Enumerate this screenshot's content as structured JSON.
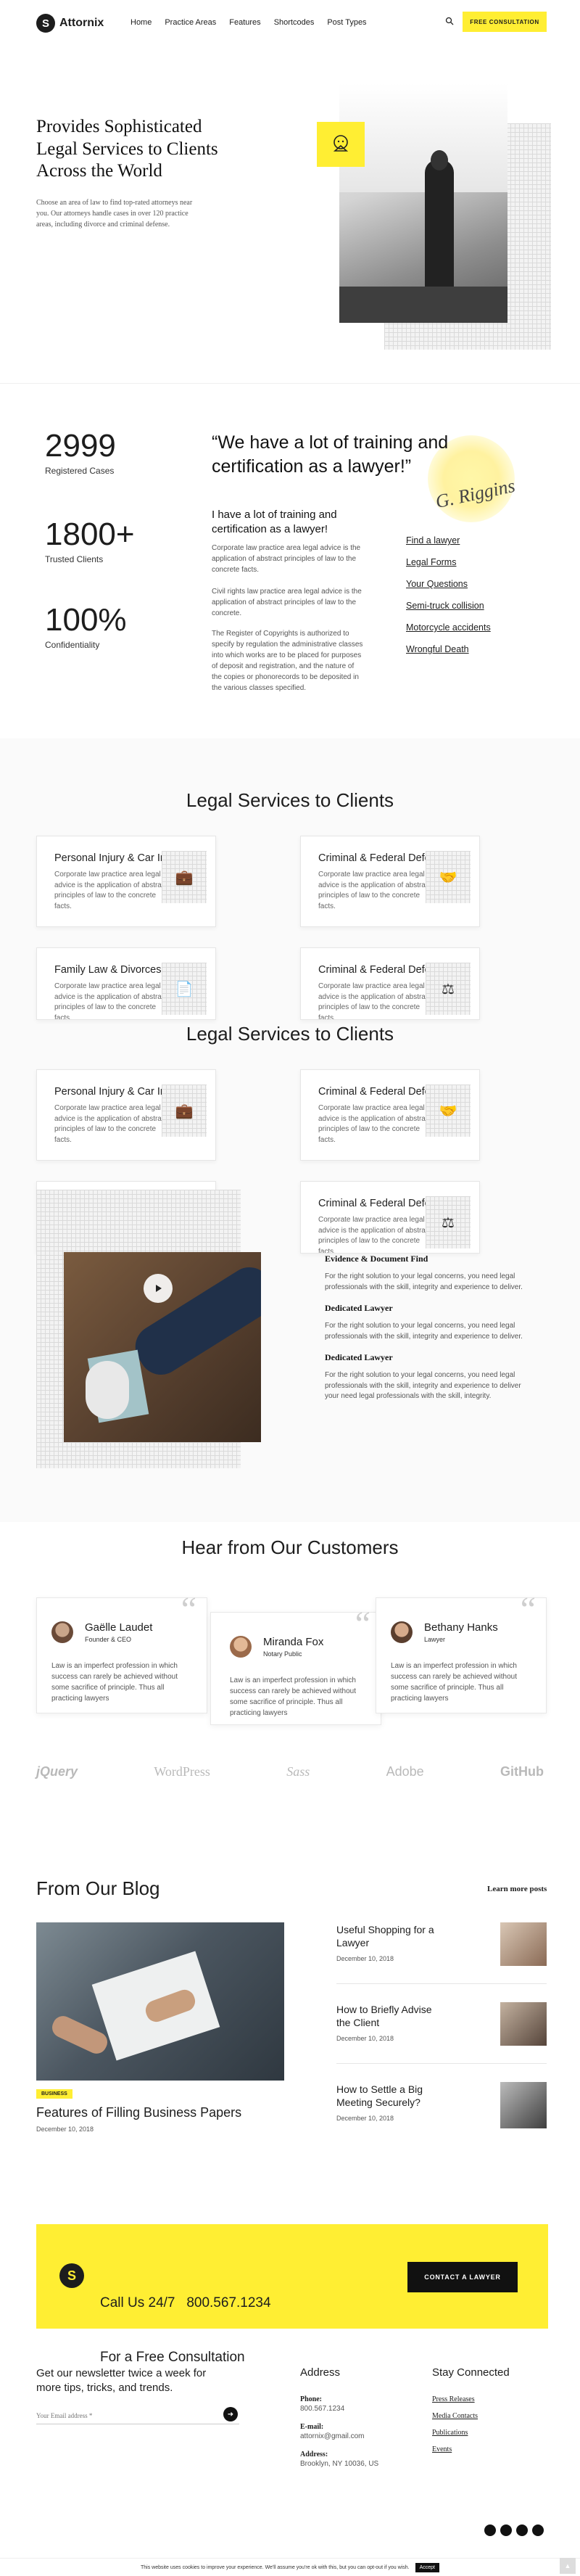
{
  "header": {
    "brand": "Attornix",
    "nav": [
      "Home",
      "Practice Areas",
      "Features",
      "Shortcodes",
      "Post Types"
    ],
    "cta": "FREE CONSULTATION"
  },
  "hero": {
    "title_lines": [
      "Provides Sophisticated",
      "Legal Services to Clients",
      "Across the World"
    ],
    "text": "Choose an area of law to find top-rated attorneys near you. Our attorneys handle cases in over 120 practice areas, including divorce and criminal defense."
  },
  "stats": [
    {
      "value": "2999",
      "label": "Registered Cases"
    },
    {
      "value": "1800+",
      "label": "Trusted Clients"
    },
    {
      "value": "100%",
      "label": "Confidentiality"
    }
  ],
  "quote": {
    "text": "“We have a lot of training and certification as a lawyer!”",
    "signature": "G. Riggins",
    "subtitle": "I have a lot of training and certification as a lawyer!",
    "paragraphs": [
      "Corporate law practice area legal advice is the application of abstract principles of law to the concrete facts.",
      "Civil rights law practice area legal advice is the application of abstract principles of law to the concrete.",
      "The Register of Copyrights is authorized to specify by regulation the administrative classes into which works are to be placed for purposes of deposit and registration, and the nature of the copies or phonorecords to be deposited in the various classes specified."
    ],
    "links": [
      "Find a lawyer",
      "Legal Forms",
      "Your Questions",
      "Semi-truck collision",
      "Motorcycle accidents",
      "Wrongful Death"
    ]
  },
  "services": {
    "title": "Legal Services to Clients",
    "cards": [
      {
        "title": "Personal Injury & Car Incidents",
        "text": "Corporate law practice area legal advice is the application of abstract principles of law to the concrete facts.",
        "icon": "briefcase-icon",
        "glyph": "💼"
      },
      {
        "title": "Criminal & Federal Defences",
        "text": "Corporate law practice area legal advice is the application of abstract principles of law to the concrete facts.",
        "icon": "handshake-icon",
        "glyph": "🤝"
      },
      {
        "title": "Family Law & Divorces",
        "text": "Corporate law practice area legal advice is the application of abstract principles of law to the concrete facts.",
        "icon": "document-icon",
        "glyph": "📄"
      },
      {
        "title": "Criminal & Federal Defences",
        "text": "Corporate law practice area legal advice is the application of abstract principles of law to the concrete facts.",
        "icon": "scales-icon",
        "glyph": "⚖"
      }
    ]
  },
  "features": [
    {
      "title": "Evidence & Document Find",
      "text": "For the right solution to your legal concerns, you need legal professionals with the skill, integrity and experience to deliver."
    },
    {
      "title": "Dedicated Lawyer",
      "text": "For the right solution to your legal concerns, you need legal professionals with the skill, integrity and experience to deliver."
    },
    {
      "title": "Dedicated Lawyer",
      "text": "For the right solution to your legal concerns, you need legal professionals with the skill, integrity and experience to deliver your need legal professionals with the skill, integrity."
    }
  ],
  "testimonials": {
    "title": "Hear from Our Customers",
    "items": [
      {
        "name": "Gaëlle Laudet",
        "role": "Founder & CEO",
        "text": "Law is an imperfect profession in which success can rarely be achieved without some sacrifice of principle. Thus all practicing lawyers"
      },
      {
        "name": "Miranda Fox",
        "role": "Notary Public",
        "text": "Law is an imperfect profession in which success can rarely be achieved without some sacrifice of principle. Thus all practicing lawyers"
      },
      {
        "name": "Bethany Hanks",
        "role": "Lawyer",
        "text": "Law is an imperfect profession in which success can rarely be achieved without some sacrifice of principle. Thus all practicing lawyers"
      }
    ]
  },
  "partners": [
    "jQuery",
    "WordPress",
    "Sass",
    "Adobe",
    "GitHub"
  ],
  "blog": {
    "title": "From Our Blog",
    "more": "Learn more posts",
    "featured": {
      "tag": "BUSINESS",
      "title": "Features of Filling Business Papers",
      "date": "December 10, 2018"
    },
    "posts": [
      {
        "title": "Useful Shopping for a Lawyer",
        "date": "December 10, 2018"
      },
      {
        "title": "How to Briefly Advise the Client",
        "date": "December 10, 2018"
      },
      {
        "title": "How to Settle a Big Meeting Securely?",
        "date": "December 10, 2018"
      }
    ]
  },
  "cta": {
    "line1": "Call Us 24/7   800.567.1234",
    "line2": "For a Free Consultation",
    "button": "CONTACT A LAWYER"
  },
  "footer": {
    "newsletter": "Get our newsletter twice a week for more tips, tricks, and trends.",
    "email_placeholder": "Your Email address *",
    "address_title": "Address",
    "phone_label": "Phone:",
    "phone": "800.567.1234",
    "email_label": "E-mail:",
    "email": "attornix@gmail.com",
    "addr_label": "Address:",
    "addr": "Brooklyn, NY 10036, US",
    "stay_title": "Stay Connected",
    "links": [
      "Press Releases",
      "Media Contacts",
      "Publications",
      "Events"
    ]
  },
  "cookie": {
    "text": "This website uses cookies to improve your experience. We'll assume you're ok with this, but you can opt-out if you wish.",
    "button": "Accept"
  },
  "colors": {
    "accent": "#ffee33",
    "dark": "#1d1d1d"
  }
}
